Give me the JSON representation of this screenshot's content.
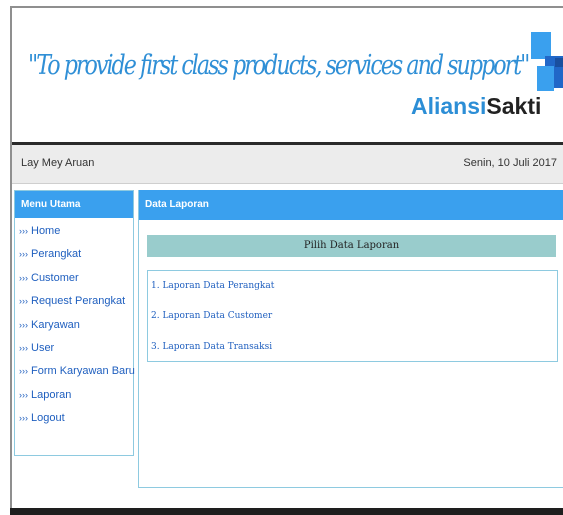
{
  "header": {
    "slogan": "\"To provide first class products, services and support\"",
    "brand_part1": "Aliansi",
    "brand_part2": "Sakti"
  },
  "userbar": {
    "user_name": "Lay Mey Aruan",
    "date": "Senin, 10 Juli 2017"
  },
  "sidebar": {
    "title": "Menu Utama",
    "prefix": "›››",
    "items": [
      {
        "label": "Home"
      },
      {
        "label": "Perangkat"
      },
      {
        "label": "Customer"
      },
      {
        "label": "Request Perangkat"
      },
      {
        "label": "Karyawan"
      },
      {
        "label": "User"
      },
      {
        "label": "Form Karyawan Baru"
      },
      {
        "label": "Laporan"
      },
      {
        "label": "Logout"
      }
    ]
  },
  "content": {
    "title": "Data Laporan",
    "report_heading": "Pilih Data Laporan",
    "reports": [
      {
        "label": "1. Laporan Data Perangkat"
      },
      {
        "label": "2. Laporan Data Customer"
      },
      {
        "label": "3. Laporan Data Transaksi"
      }
    ]
  },
  "colors": {
    "accent_blue": "#3aa0ee",
    "brand_blue": "#2c8ed6",
    "teal_heading": "#99cccc",
    "link_blue": "#1f5fbf"
  }
}
